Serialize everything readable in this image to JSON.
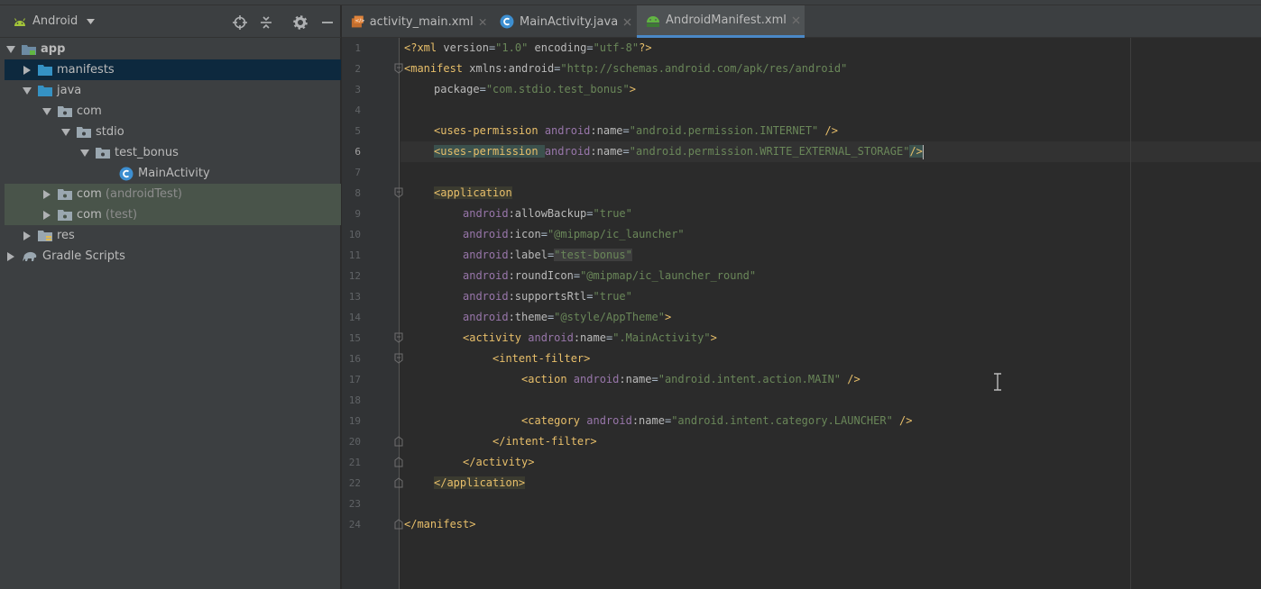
{
  "project": {
    "view_name": "Android",
    "tree": [
      {
        "label": "app",
        "arrow": "down",
        "indent": 0,
        "icon": "module-icon",
        "state": "bold"
      },
      {
        "label": "manifests",
        "arrow": "right",
        "indent": 1,
        "icon": "folder-icon",
        "state": "selected"
      },
      {
        "label": "java",
        "arrow": "down",
        "indent": 1,
        "icon": "folder-icon",
        "state": ""
      },
      {
        "label": "com",
        "arrow": "down",
        "indent": 2,
        "icon": "package-icon",
        "state": ""
      },
      {
        "label": "stdio",
        "arrow": "down",
        "indent": 3,
        "icon": "package-icon",
        "state": ""
      },
      {
        "label": "test_bonus",
        "arrow": "down",
        "indent": 4,
        "icon": "package-icon",
        "state": ""
      },
      {
        "label": "MainActivity",
        "arrow": "",
        "indent": 5,
        "icon": "java-class-icon",
        "state": ""
      },
      {
        "label": "com",
        "suffix": "(androidTest)",
        "arrow": "right",
        "indent": 2,
        "icon": "package-icon",
        "state": "scope"
      },
      {
        "label": "com",
        "suffix": "(test)",
        "arrow": "right",
        "indent": 2,
        "icon": "package-icon",
        "state": "scope"
      },
      {
        "label": "res",
        "arrow": "right",
        "indent": 1,
        "icon": "res-folder-icon",
        "state": ""
      },
      {
        "label": "Gradle Scripts",
        "arrow": "right",
        "indent": 0,
        "icon": "gradle-icon",
        "state": ""
      }
    ]
  },
  "tabs": [
    {
      "label": "activity_main.xml",
      "icon": "xml-layout-icon",
      "active": false
    },
    {
      "label": "MainActivity.java",
      "icon": "java-class-icon",
      "active": false
    },
    {
      "label": "AndroidManifest.xml",
      "icon": "manifest-icon",
      "active": true
    }
  ],
  "editor": {
    "current_line": 6,
    "line_numbers": [
      "1",
      "2",
      "3",
      "4",
      "5",
      "6",
      "7",
      "8",
      "9",
      "10",
      "11",
      "12",
      "13",
      "14",
      "15",
      "16",
      "17",
      "18",
      "19",
      "20",
      "21",
      "22",
      "23",
      "24"
    ],
    "code": {
      "l1_pi_open": "<?xml ",
      "l1_a1": "version",
      "l1_eq1": "=",
      "l1_v1": "\"1.0\"",
      "l1_a2": " encoding",
      "l1_eq2": "=",
      "l1_v2": "\"utf-8\"",
      "l1_pi_close": "?>",
      "l2_tag": "<manifest ",
      "l2_attr": "xmlns:android",
      "l2_eq": "=",
      "l2_val": "\"http://schemas.android.com/apk/res/android\"",
      "l3_attr": "package",
      "l3_eq": "=",
      "l3_val": "\"com.stdio.test_bonus\"",
      "l3_close": ">",
      "l5_tag": "<uses-permission ",
      "l5_ns": "android",
      "l5_attr": ":name",
      "l5_eq": "=",
      "l5_val": "\"android.permission.INTERNET\"",
      "l5_close": " />",
      "l6_tag": "<uses-permission ",
      "l6_ns": "android",
      "l6_attr": ":name",
      "l6_eq": "=",
      "l6_val": "\"android.permission.WRITE_EXTERNAL_STORAGE\"",
      "l6_close": "/>",
      "l8_tag": "<application",
      "l9_ns": "android",
      "l9_attr": ":allowBackup",
      "l9_eq": "=",
      "l9_val": "\"true\"",
      "l10_ns": "android",
      "l10_attr": ":icon",
      "l10_eq": "=",
      "l10_val": "\"@mipmap/ic_launcher\"",
      "l11_ns": "android",
      "l11_attr": ":label",
      "l11_eq": "=",
      "l11_val": "\"test-bonus\"",
      "l12_ns": "android",
      "l12_attr": ":roundIcon",
      "l12_eq": "=",
      "l12_val": "\"@mipmap/ic_launcher_round\"",
      "l13_ns": "android",
      "l13_attr": ":supportsRtl",
      "l13_eq": "=",
      "l13_val": "\"true\"",
      "l14_ns": "android",
      "l14_attr": ":theme",
      "l14_eq": "=",
      "l14_val": "\"@style/AppTheme\"",
      "l14_close": ">",
      "l15_tag": "<activity ",
      "l15_ns": "android",
      "l15_attr": ":name",
      "l15_eq": "=",
      "l15_val": "\".MainActivity\"",
      "l15_close": ">",
      "l16_tag": "<intent-filter>",
      "l17_tag": "<action ",
      "l17_ns": "android",
      "l17_attr": ":name",
      "l17_eq": "=",
      "l17_val": "\"android.intent.action.MAIN\"",
      "l17_close": " />",
      "l19_tag": "<category ",
      "l19_ns": "android",
      "l19_attr": ":name",
      "l19_eq": "=",
      "l19_val": "\"android.intent.category.LAUNCHER\"",
      "l19_close": " />",
      "l20_tag": "</intent-filter>",
      "l21_tag": "</activity>",
      "l22_tag": "</application>",
      "l24_tag": "</manifest>"
    }
  },
  "colors": {
    "tag": "#e8bf6a",
    "namespace": "#9876aa",
    "attribute": "#bababa",
    "string": "#6a8759",
    "selection": "#0d293e",
    "active_tab_underline": "#4a88c7"
  }
}
